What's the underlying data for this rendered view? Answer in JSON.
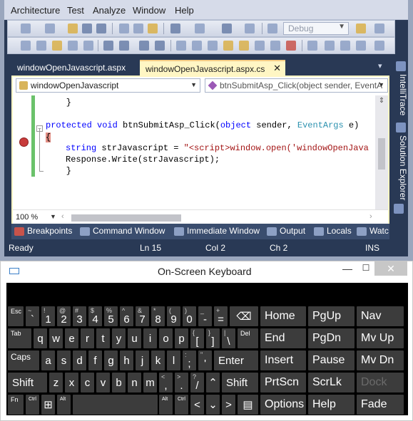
{
  "menubar": {
    "items": [
      "Architecture",
      "Test",
      "Analyze",
      "Window",
      "Help"
    ]
  },
  "toolbar": {
    "config_dropdown": "Debug"
  },
  "tabs": {
    "inactive": "windowOpenJavascript.aspx",
    "active": "windowOpenJavascript.aspx.cs",
    "close_glyph": "✕"
  },
  "editor": {
    "class_combo": "windowOpenJavascript",
    "member_combo": "btnSubmitAsp_Click(object sender, EventA",
    "code": {
      "line1": "    }",
      "line3_kw": "protected void ",
      "line3_name": "btnSubmitAsp_Click(",
      "line3_kw2": "object",
      "line3_mid": " sender, ",
      "line3_type": "EventArgs",
      "line3_end": " e)",
      "line4": "{",
      "line6_kw": "string",
      "line6_mid": " strJavascript = ",
      "line6_str": "\"<script>window.open('windowOpenJava",
      "line7": "Response.Write(strJavascript);",
      "line8": "    }",
      "line9": "}"
    },
    "zoom": "100 %"
  },
  "side_tabs": {
    "intellitrace": "IntelliTrace",
    "solution_explorer": "Solution Explorer"
  },
  "bottom_tabs": [
    "Breakpoints",
    "Command Window",
    "Immediate Window",
    "Output",
    "Locals",
    "Watc"
  ],
  "statusbar": {
    "state": "Ready",
    "line": "Ln 15",
    "col": "Col 2",
    "ch": "Ch 2",
    "mode": "INS"
  },
  "osk": {
    "title": "On-Screen Keyboard",
    "row1": {
      "esc": "Esc",
      "tilde_hi": "~",
      "tilde_lo": "`",
      "k1_hi": "!",
      "k1": "1",
      "k2_hi": "@",
      "k2": "2",
      "k3_hi": "#",
      "k3": "3",
      "k4_hi": "$",
      "k4": "4",
      "k5_hi": "%",
      "k5": "5",
      "k6_hi": "^",
      "k6": "6",
      "k7_hi": "&",
      "k7": "7",
      "k8_hi": "*",
      "k8": "8",
      "k9_hi": "(",
      "k9": "9",
      "k0_hi": ")",
      "k0": "0",
      "minus_hi": "_",
      "minus": "-",
      "plus_hi": "+",
      "plus": "=",
      "backspace": "⌫"
    },
    "row2": {
      "tab": "Tab",
      "letters": [
        "q",
        "w",
        "e",
        "r",
        "t",
        "y",
        "u",
        "i",
        "o",
        "p"
      ],
      "lb_hi": "{",
      "lb": "[",
      "rb_hi": "}",
      "rb": "]",
      "bs_hi": "|",
      "bs": "\\",
      "del": "Del"
    },
    "row3": {
      "caps": "Caps",
      "letters": [
        "a",
        "s",
        "d",
        "f",
        "g",
        "h",
        "j",
        "k",
        "l"
      ],
      "semi_hi": ":",
      "semi": ";",
      "quote_hi": "\"",
      "quote": "'",
      "enter": "Enter"
    },
    "row4": {
      "shift_l": "Shift",
      "letters": [
        "z",
        "x",
        "c",
        "v",
        "b",
        "n",
        "m"
      ],
      "comma_hi": "<",
      "comma": ",",
      "period_hi": ">",
      "period": ".",
      "slash_hi": "?",
      "slash": "/",
      "up": "⌃",
      "shift_r": "Shift"
    },
    "row5": {
      "fn": "Fn",
      "ctrl_l": "Ctrl",
      "win": "⊞",
      "alt_l": "Alt",
      "alt_r": "Alt",
      "ctrl_r": "Ctrl",
      "left": "<",
      "down": "⌄",
      "right": ">",
      "menu": "▤"
    },
    "nav": [
      [
        "Home",
        "PgUp",
        "Nav"
      ],
      [
        "End",
        "PgDn",
        "Mv Up"
      ],
      [
        "Insert",
        "Pause",
        "Mv Dn"
      ],
      [
        "PrtScn",
        "ScrLk",
        "Dock"
      ],
      [
        "Options",
        "Help",
        "Fade"
      ]
    ]
  }
}
